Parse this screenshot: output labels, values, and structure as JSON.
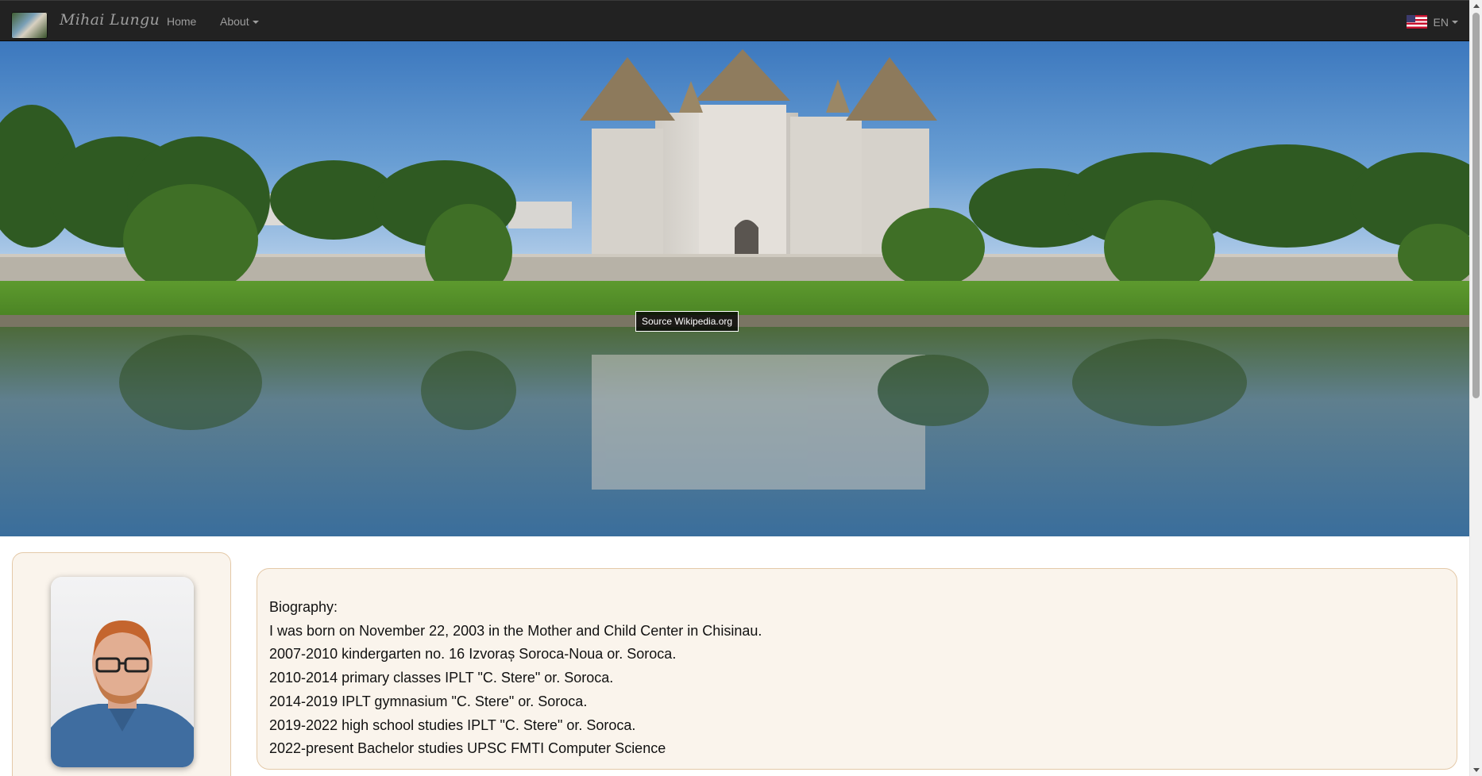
{
  "navbar": {
    "brand": "Mihai Lungu",
    "home_label": "Home",
    "about_label": "About",
    "language_label": "EN",
    "language_flag": "us-flag-icon"
  },
  "hero": {
    "image_caption": "Source Wikipedia.org",
    "image_subject": "castle-photo"
  },
  "profile": {
    "avatar": "profile-photo"
  },
  "biography": {
    "lines": [
      "Biography:",
      "I was born on November 22, 2003 in the Mother and Child Center in Chisinau.",
      "2007-2010 kindergarten no. 16 Izvoraș Soroca-Noua or. Soroca.",
      "2010-2014 primary classes IPLT \"C. Stere\" or. Soroca.",
      "2014-2019 IPLT gymnasium \"C. Stere\" or. Soroca.",
      "2019-2022 high school studies IPLT \"C. Stere\" or. Soroca.",
      "2022-present Bachelor studies UPSC FMTI Computer Science"
    ]
  },
  "colors": {
    "navbar_bg": "#222222",
    "nav_text": "#9d9d9d",
    "card_bg": "#faf4ec",
    "card_border": "#e4c9a8"
  }
}
